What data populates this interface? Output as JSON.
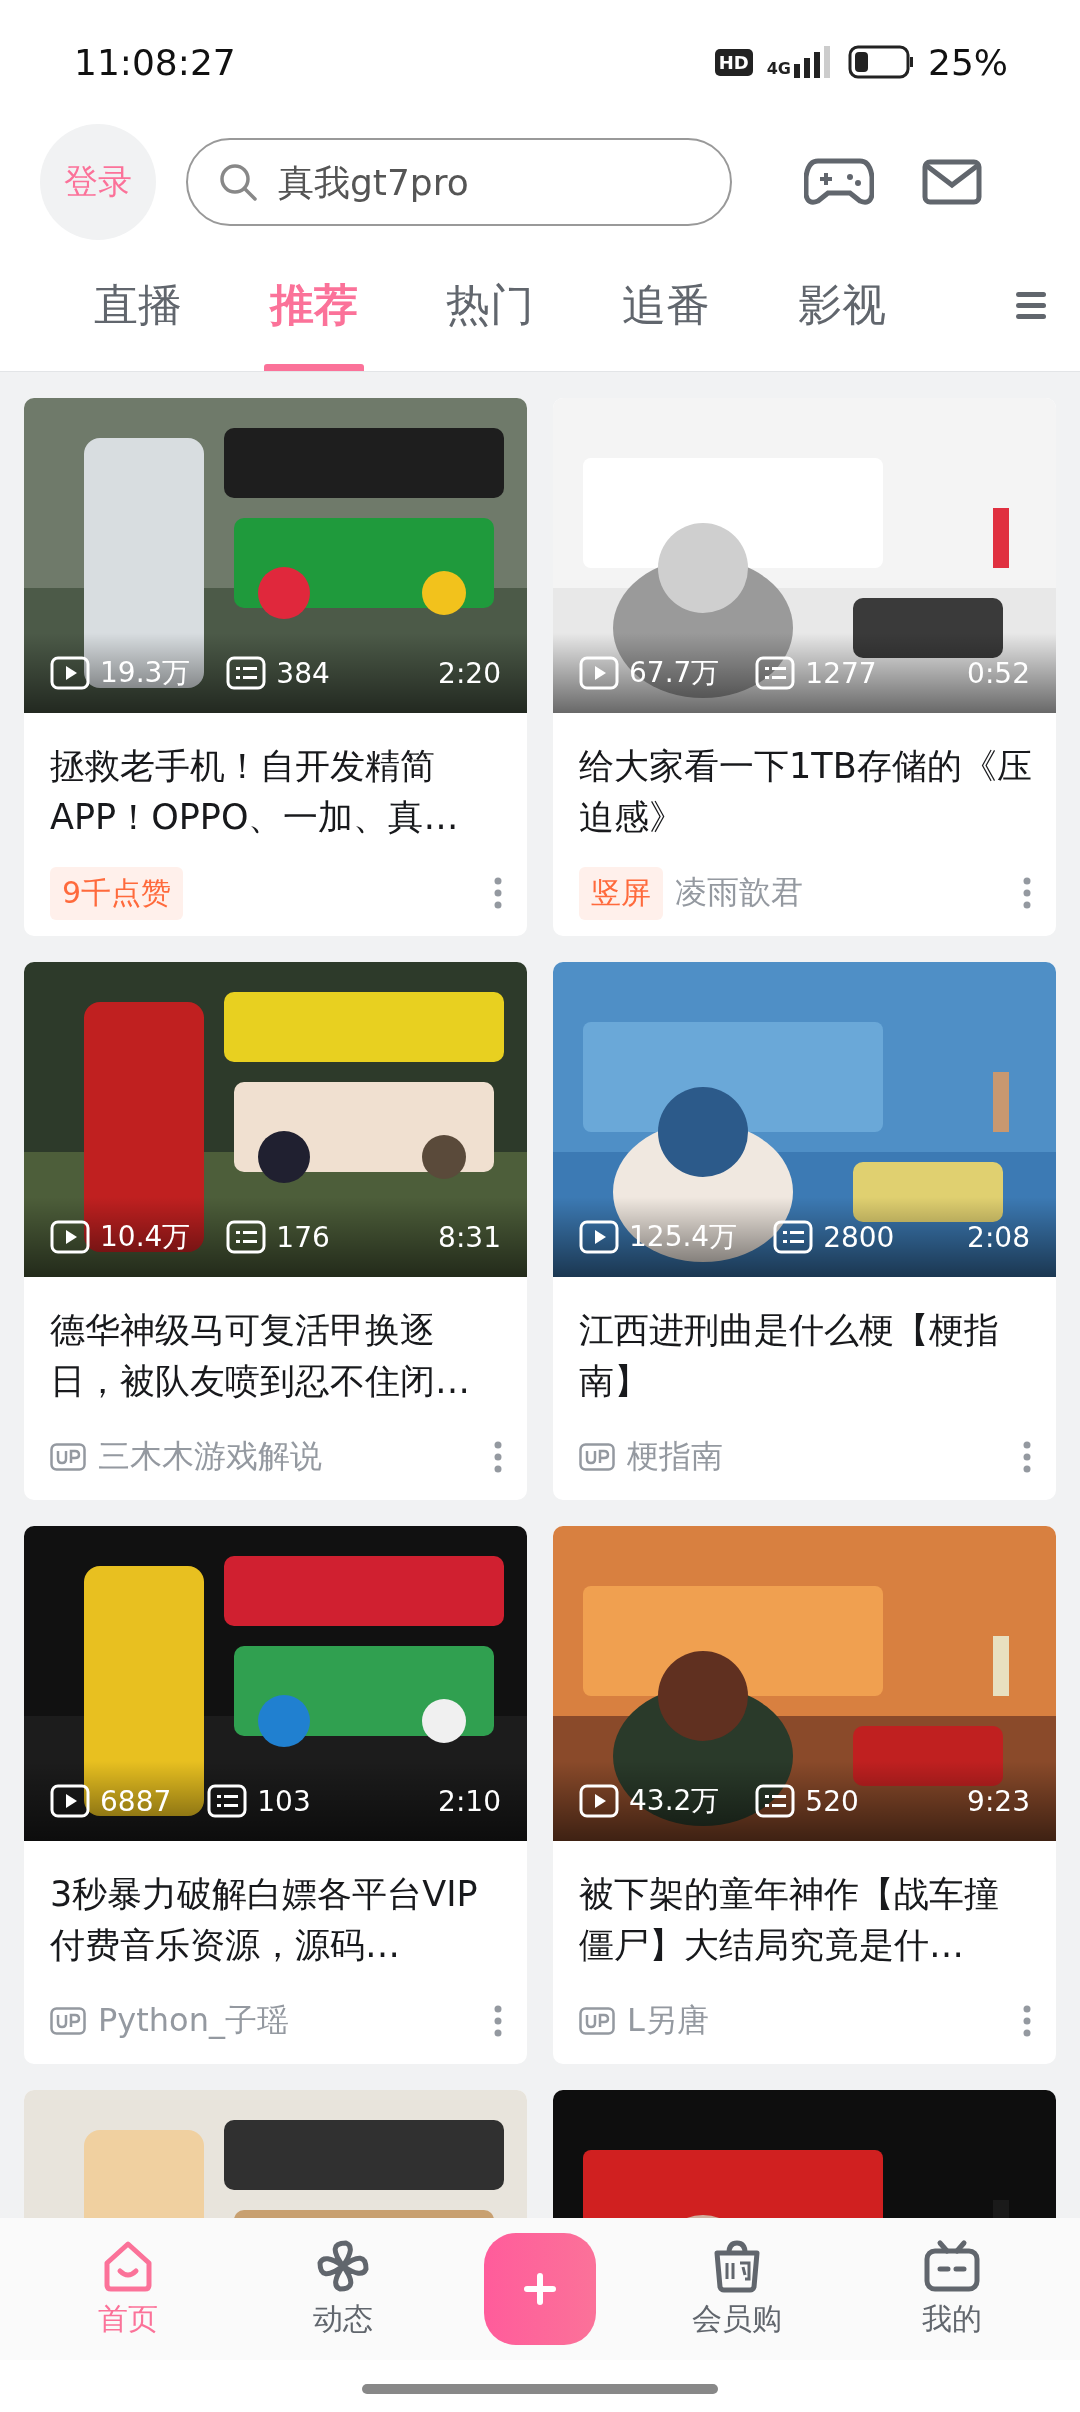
{
  "status_bar": {
    "time": "11:08:27",
    "hd": "HD",
    "network": "4G",
    "battery": "25%"
  },
  "header": {
    "login": "登录",
    "search": {
      "placeholder": "真我gt7pro"
    }
  },
  "tabs": [
    {
      "label": "直播",
      "selected": false
    },
    {
      "label": "推荐",
      "selected": true
    },
    {
      "label": "热门",
      "selected": false
    },
    {
      "label": "追番",
      "selected": false
    },
    {
      "label": "影视",
      "selected": false
    }
  ],
  "feed": [
    {
      "thumbnail": {
        "kind": "picture"
      },
      "plays": "19.3万",
      "comments": "384",
      "duration": "2:20",
      "title": "拯救老手机！自开发精简APP！OPPO、一加、真…",
      "badge": "9千点赞"
    },
    {
      "thumbnail": {
        "kind": "picture"
      },
      "plays": "67.7万",
      "comments": "1277",
      "duration": "0:52",
      "title": "给大家看一下1TB存储的《压迫感》",
      "badge": "竖屏",
      "author": "凌雨歆君",
      "up_mark": false
    },
    {
      "thumbnail": {
        "kind": "picture"
      },
      "plays": "10.4万",
      "comments": "176",
      "duration": "8:31",
      "title": "德华神级马可复活甲换逐日，被队友喷到忍不住闭…",
      "author": "三木木游戏解说",
      "up_mark": true
    },
    {
      "thumbnail": {
        "kind": "picture"
      },
      "plays": "125.4万",
      "comments": "2800",
      "duration": "2:08",
      "title": "江西进刑曲是什么梗【梗指南】",
      "author": "梗指南",
      "up_mark": true
    },
    {
      "thumbnail": {
        "kind": "picture"
      },
      "plays": "6887",
      "comments": "103",
      "duration": "2:10",
      "title": "3秒暴力破解白嫖各平台VIP付费音乐资源，源码…",
      "author": "Python_子瑶",
      "up_mark": true
    },
    {
      "thumbnail": {
        "kind": "picture"
      },
      "plays": "43.2万",
      "comments": "520",
      "duration": "9:23",
      "title": "被下架的童年神作【战车撞僵尸】大结局究竟是什…",
      "author": "L另唐",
      "up_mark": true
    },
    {
      "thumbnail": {
        "kind": "picture"
      }
    },
    {
      "thumbnail": {
        "kind": "picture"
      }
    }
  ],
  "bottom_nav": [
    {
      "kind": "tab",
      "label": "首页",
      "selected": true
    },
    {
      "kind": "tab",
      "label": "动态",
      "selected": false
    },
    {
      "kind": "publish"
    },
    {
      "kind": "tab",
      "label": "会员购",
      "selected": false
    },
    {
      "kind": "tab",
      "label": "我的",
      "selected": false
    }
  ]
}
